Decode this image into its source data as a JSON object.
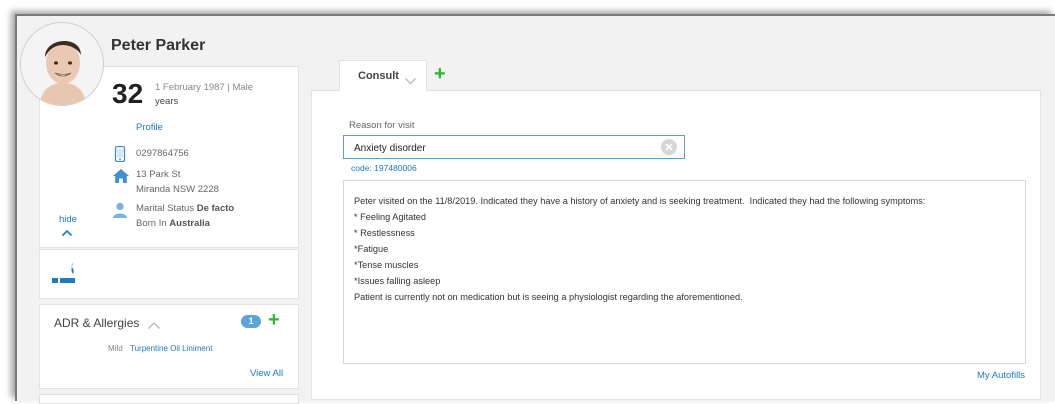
{
  "patient": {
    "name": "Peter Parker",
    "age": "32",
    "dob_gender": "1 February 1987 | Male",
    "age_unit": "years",
    "profile_link": "Profile",
    "phone": "0297864756",
    "address_line1": "13 Park St",
    "address_line2": "Miranda NSW 2228",
    "marital_label": "Marital Status",
    "marital_value": "De facto",
    "born_label": "Born In",
    "born_value": "Australia",
    "hide_link": "hide"
  },
  "adr": {
    "title": "ADR & Allergies",
    "count": "1",
    "items": [
      {
        "severity": "Mild",
        "name": "Turpentine Oil Liniment"
      }
    ],
    "view_all": "View All"
  },
  "tabs": [
    {
      "label": "Consult"
    }
  ],
  "consult": {
    "reason_label": "Reason for visit",
    "reason_value": "Anxiety disorder",
    "code": "code: 197480006",
    "notes": [
      "Peter visited on the 11/8/2019. Indicated they have a history of anxiety and is seeking treatment.  Indicated they had the following symptoms:",
      "",
      "* Feeling Agitated",
      "* Restlessness",
      "*Fatigue",
      "*Tense muscles",
      "*Issues falling asleep",
      "",
      "Patient is currently not on medication but is seeing a physiologist regarding the aforementioned."
    ],
    "autofills_link": "My Autofills"
  },
  "icons": {
    "phone": "mobile-phone-icon",
    "address": "home-icon",
    "marital": "person-icon",
    "tobacco": "tobacco-icon",
    "tab_dropdown": "chevron-down-icon",
    "add": "plus-icon",
    "clear": "clear-icon"
  },
  "colors": {
    "link": "#1f7ac2",
    "add": "#2fb52f",
    "badge": "#5aa5da",
    "input_border": "#5a9fc5"
  }
}
